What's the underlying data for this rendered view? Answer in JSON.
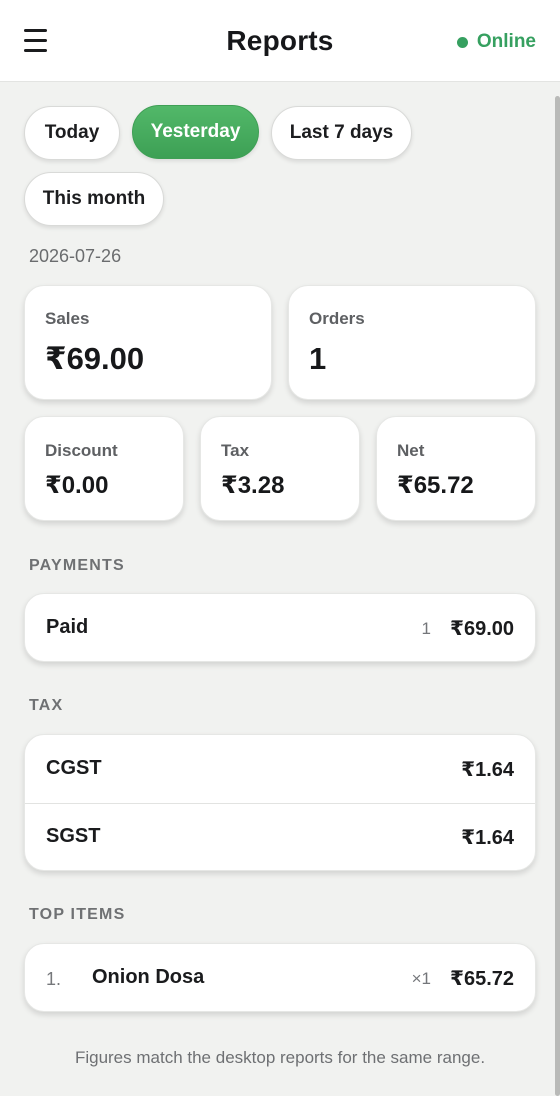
{
  "header": {
    "title": "Reports",
    "status": "Online"
  },
  "filters": {
    "today": "Today",
    "yesterday": "Yesterday",
    "last7": "Last 7 days",
    "month": "This month",
    "active": "Yesterday"
  },
  "date": "2026-07-26",
  "summary": {
    "sales_label": "Sales",
    "sales_value": "₹69.00",
    "orders_label": "Orders",
    "orders_value": "1",
    "discount_label": "Discount",
    "discount_value": "₹0.00",
    "tax_label": "Tax",
    "tax_value": "₹3.28",
    "net_label": "Net",
    "net_value": "₹65.72"
  },
  "payments": {
    "title": "PAYMENTS",
    "rows": [
      {
        "name": "Paid",
        "count": "1",
        "amount": "₹69.00"
      }
    ]
  },
  "tax": {
    "title": "TAX",
    "rows": [
      {
        "name": "CGST",
        "amount": "₹1.64"
      },
      {
        "name": "SGST",
        "amount": "₹1.64"
      }
    ]
  },
  "top_items": {
    "title": "TOP ITEMS",
    "rows": [
      {
        "rank": "1.",
        "name": "Onion Dosa",
        "qty": "×1",
        "amount": "₹65.72"
      }
    ]
  },
  "footnote": "Figures match the desktop reports for the same range.",
  "colors": {
    "accent": "#3da055",
    "background": "#f1f2f0",
    "card": "#ffffff"
  }
}
